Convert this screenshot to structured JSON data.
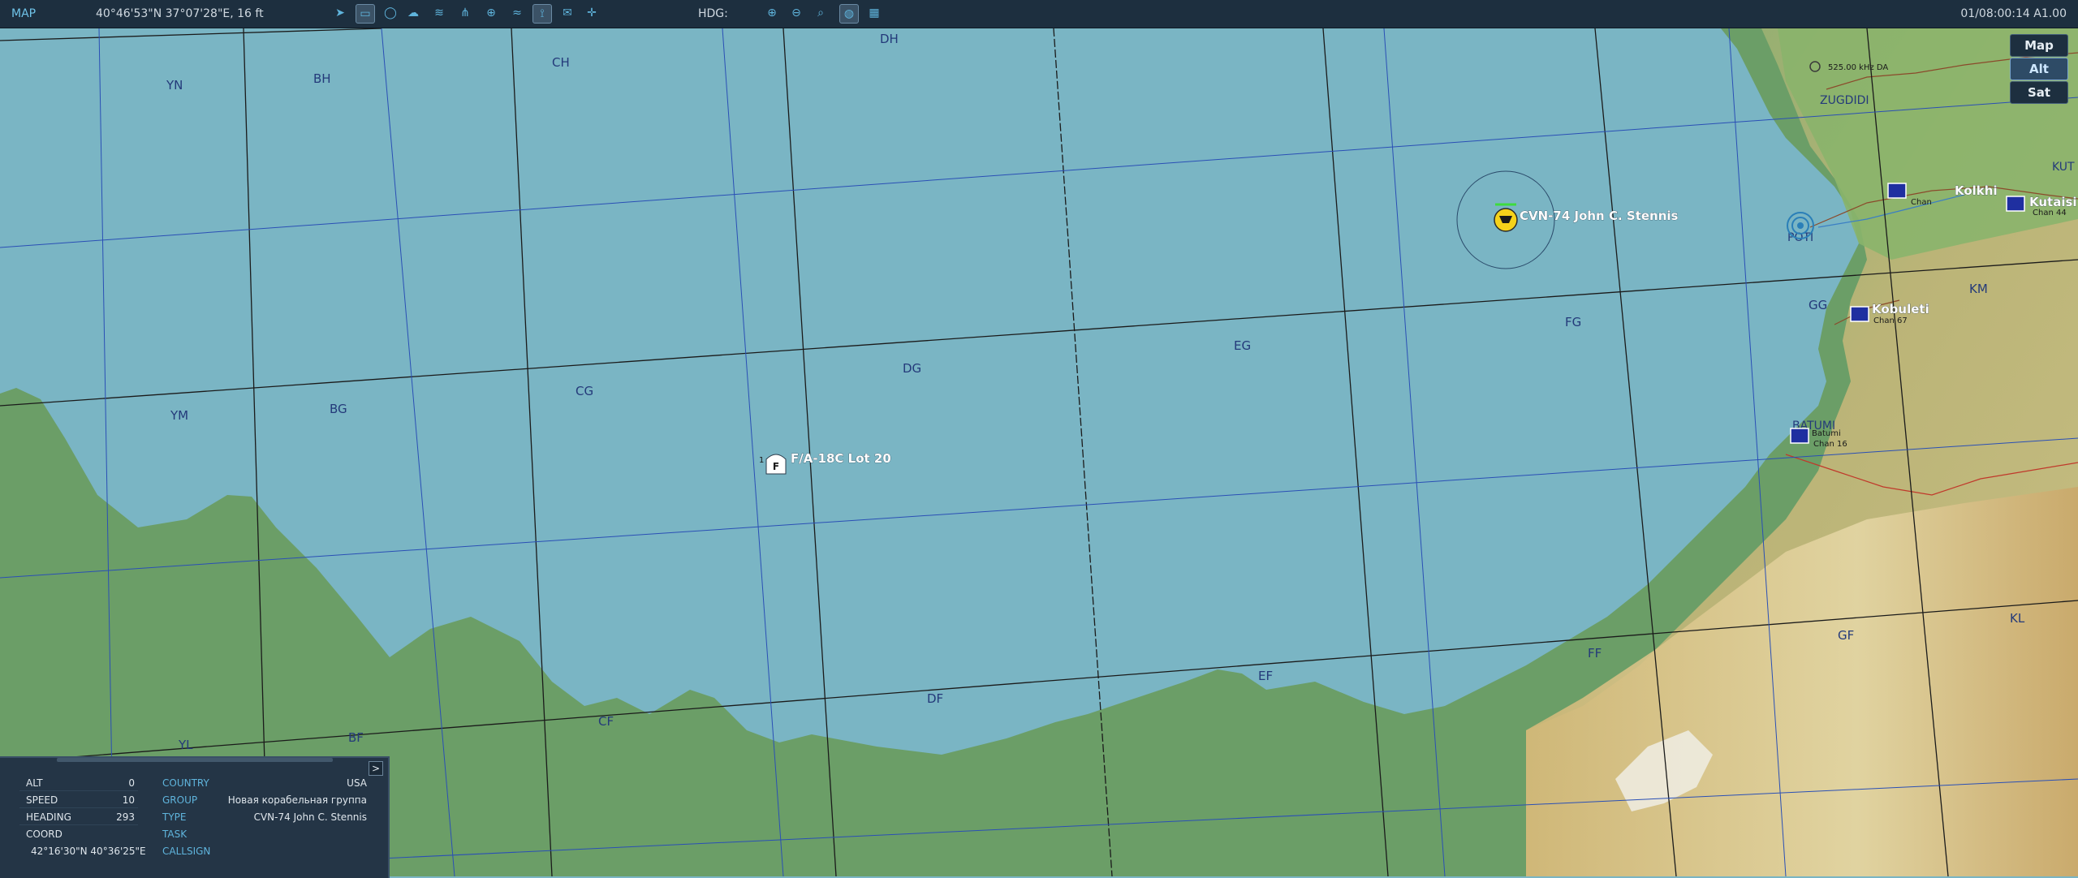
{
  "toolbar": {
    "mode": "MAP",
    "cursor_coord": "40°46'53\"N 37°07'28\"E, 16 ft",
    "hdg_label": "HDG:",
    "clock": "01/08:00:14 A1.00",
    "tools": [
      "nav-arrow",
      "ruler",
      "circle",
      "cloud",
      "rain",
      "network",
      "target",
      "wifi",
      "tower",
      "chat",
      "crosshair"
    ],
    "zoom_tools": [
      "zoom-in",
      "zoom-out",
      "zoom-fit",
      "globe",
      "grid"
    ]
  },
  "layers": {
    "map": "Map",
    "alt": "Alt",
    "sat": "Sat",
    "active": "Alt"
  },
  "grid_labels": [
    "YN",
    "BH",
    "CH",
    "DH",
    "YM",
    "BG",
    "CG",
    "DG",
    "EG",
    "FG",
    "GG",
    "KM",
    "YL",
    "BF",
    "CF",
    "DF",
    "EF",
    "FF",
    "GF",
    "KL"
  ],
  "places": {
    "zugdidi": "ZUGDIDI",
    "poti": "POTI",
    "batumi": "BATUMI",
    "kutaisi": "KUT",
    "beacon": "525.00 kHz DA"
  },
  "units": {
    "carrier": "CVN-74 John C. Stennis",
    "aircraft": "F/A-18C Lot 20",
    "aircraft_group_num": "1",
    "aircraft_symbol": "F",
    "airfield_kolkhi": "Kolkhi",
    "airfield_kobuleti": "Kobuleti",
    "airfield_batumi": "Batumi",
    "airfield_kutaisi": "Kutaisi",
    "chan_kolkhi": "Chan",
    "chan_kobuleti": "Chan 67",
    "chan_batumi": "Chan 16",
    "chan_kutaisi": "Chan 44"
  },
  "info_panel": {
    "toggle": ">",
    "alt_label": "ALT",
    "alt_value": "0",
    "speed_label": "SPEED",
    "speed_value": "10",
    "heading_label": "HEADING",
    "heading_value": "293",
    "coord_label": "COORD",
    "coord_value": "42°16'30\"N 40°36'25\"E",
    "country_label": "COUNTRY",
    "country_value": "USA",
    "group_label": "GROUP",
    "group_value": "Новая корабельная группа",
    "type_label": "TYPE",
    "type_value": "CVN-74 John C. Stennis",
    "task_label": "TASK",
    "task_value": "",
    "callsign_label": "CALLSIGN",
    "callsign_value": ""
  },
  "colors": {
    "sea": "#7ab5c4",
    "land": "#6b9e67",
    "toolbar": "#1d2f3f",
    "accent": "#5fb4dc",
    "grid_black": "#1a1a1a",
    "grid_blue": "#2a4fb5"
  }
}
